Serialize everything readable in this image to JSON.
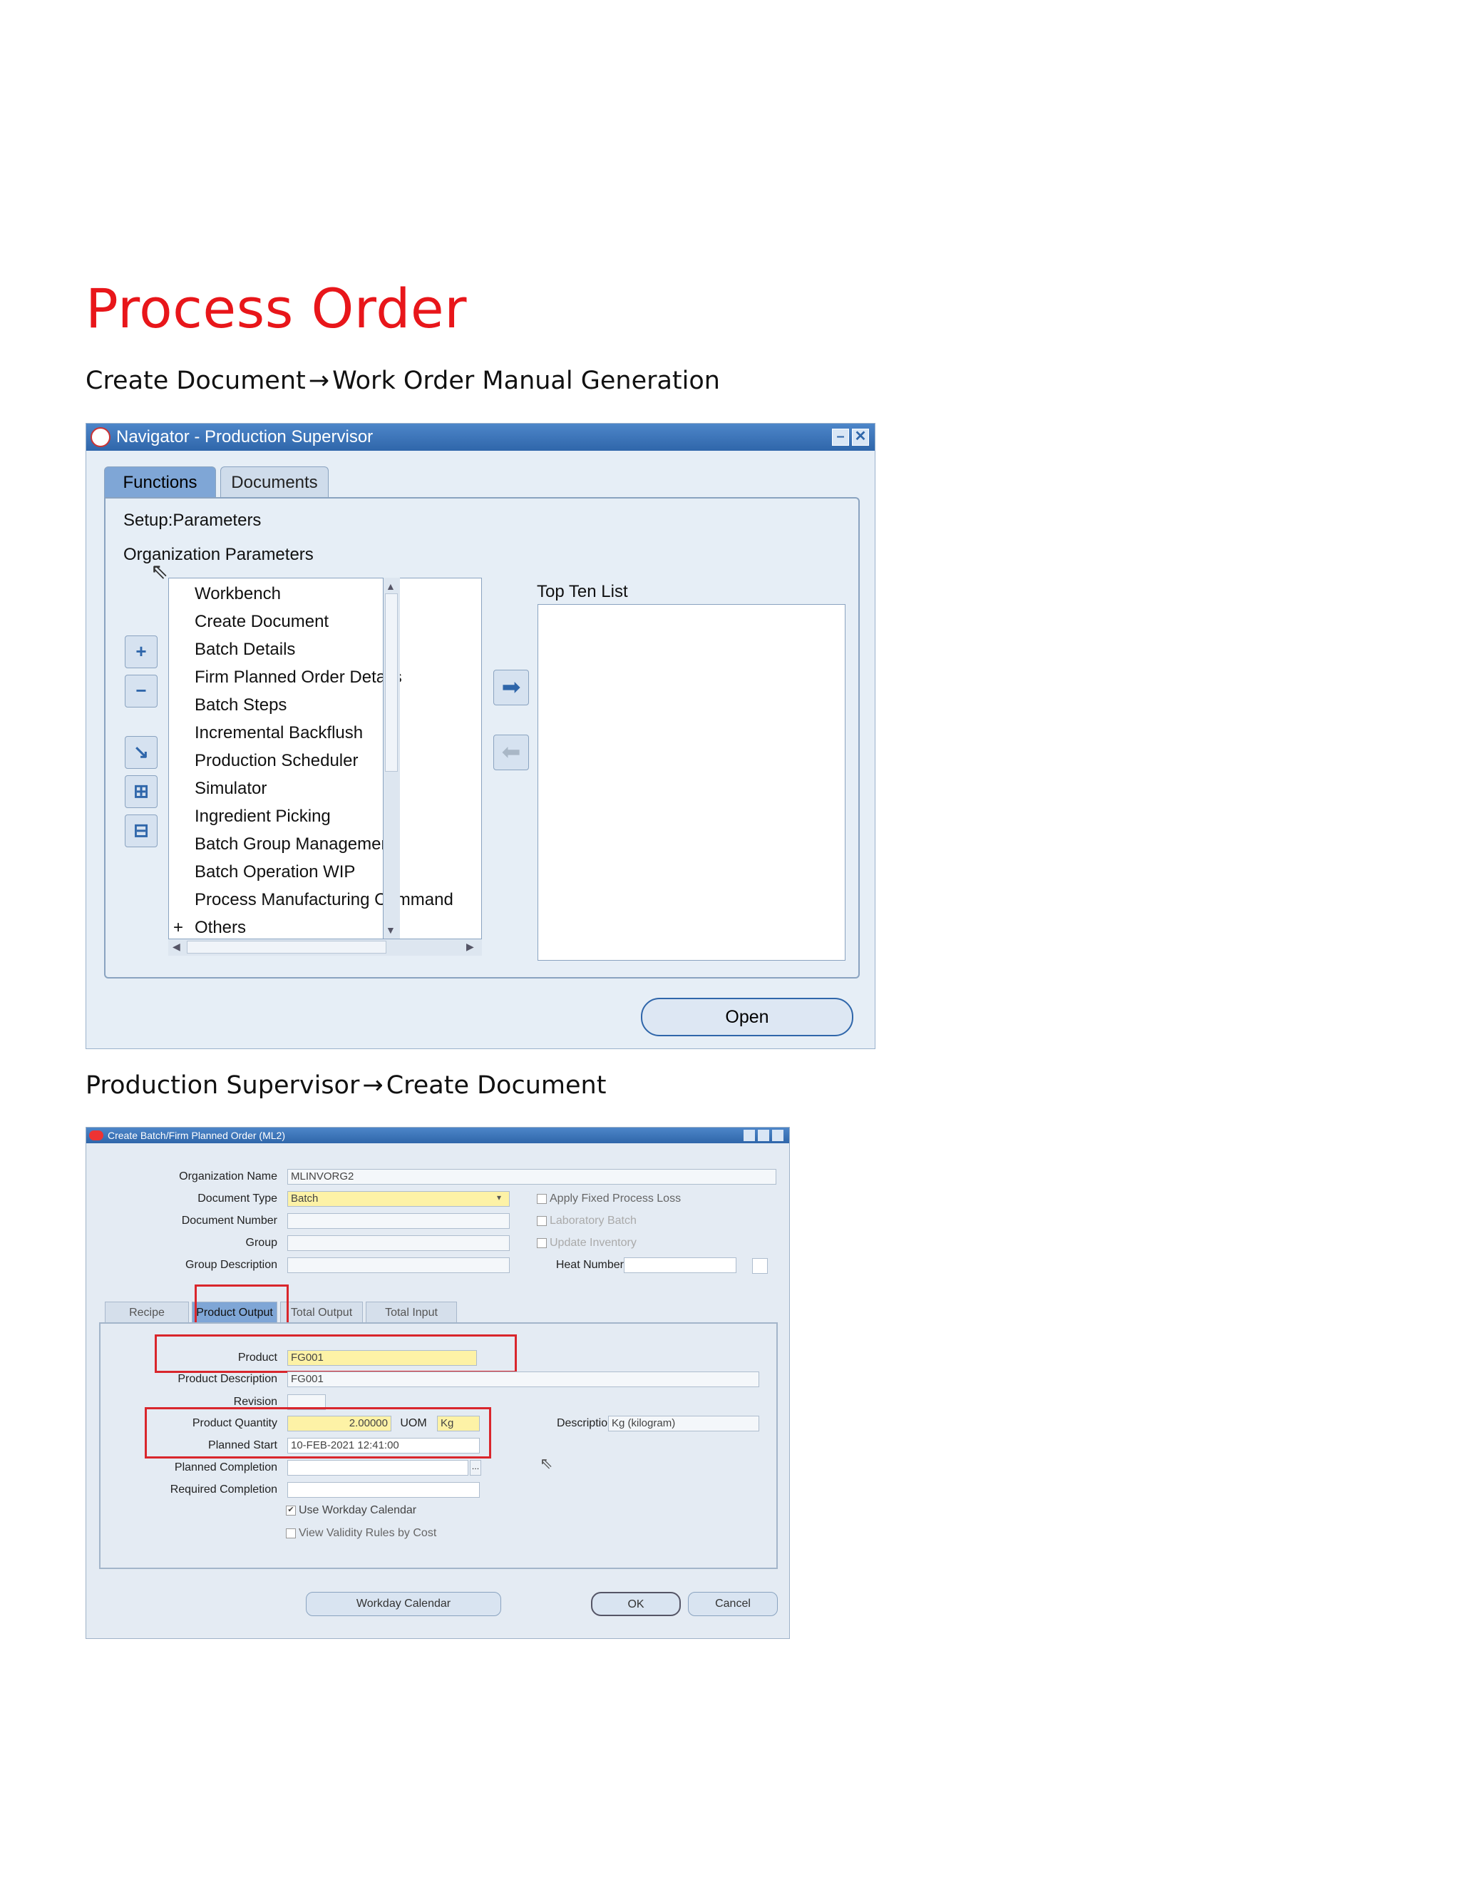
{
  "page": {
    "title": "Process Order",
    "caption1": {
      "left": "Create Document",
      "arrow": "→",
      "right": "Work Order Manual Generation"
    },
    "caption2": {
      "left": "Production Supervisor",
      "arrow": "→",
      "right": "Create Document"
    }
  },
  "navigator": {
    "window_title": "Navigator - Production Supervisor",
    "tabs": [
      "Functions",
      "Documents"
    ],
    "active_tab": "Functions",
    "setup_text": "Setup:Parameters",
    "org_text": "Organization Parameters",
    "list_items": [
      "Workbench",
      "Create Document",
      "Batch Details",
      "Firm Planned Order Details",
      "Batch Steps",
      "Incremental Backflush",
      "Production Scheduler",
      "Simulator",
      "Ingredient Picking",
      "Batch Group Management",
      "Batch Operation WIP",
      "Process Manufacturing Command"
    ],
    "others_prefix": "+",
    "others_label": "Others",
    "top_ten_label": "Top Ten List",
    "open_button": "Open"
  },
  "create_batch": {
    "window_title": "Create Batch/Firm Planned Order (ML2)",
    "labels": {
      "org_name": "Organization Name",
      "doc_type": "Document Type",
      "doc_number": "Document Number",
      "group": "Group",
      "group_desc": "Group Description",
      "heat_number": "Heat Number",
      "product": "Product",
      "product_desc": "Product Description",
      "revision": "Revision",
      "product_qty": "Product Quantity",
      "uom": "UOM",
      "description": "Description",
      "planned_start": "Planned Start",
      "planned_completion": "Planned Completion",
      "required_completion": "Required Completion"
    },
    "values": {
      "org_name": "MLINVORG2",
      "doc_type": "Batch",
      "product": "FG001",
      "product_desc": "FG001",
      "product_qty": "2.00000",
      "uom": "Kg",
      "description": "Kg (kilogram)",
      "planned_start": "10-FEB-2021 12:41:00"
    },
    "checkboxes": {
      "apply_fixed": "Apply Fixed Process Loss",
      "lab_batch": "Laboratory Batch",
      "update_inventory": "Update Inventory",
      "use_workday": "Use Workday Calendar",
      "view_validity": "View Validity Rules by Cost"
    },
    "tabs": [
      "Recipe",
      "Product Output",
      "Total Output",
      "Total Input"
    ],
    "active_tab": "Product Output",
    "buttons": {
      "workday": "Workday Calendar",
      "ok": "OK",
      "cancel": "Cancel"
    },
    "highlight_color": "#d9262c"
  }
}
